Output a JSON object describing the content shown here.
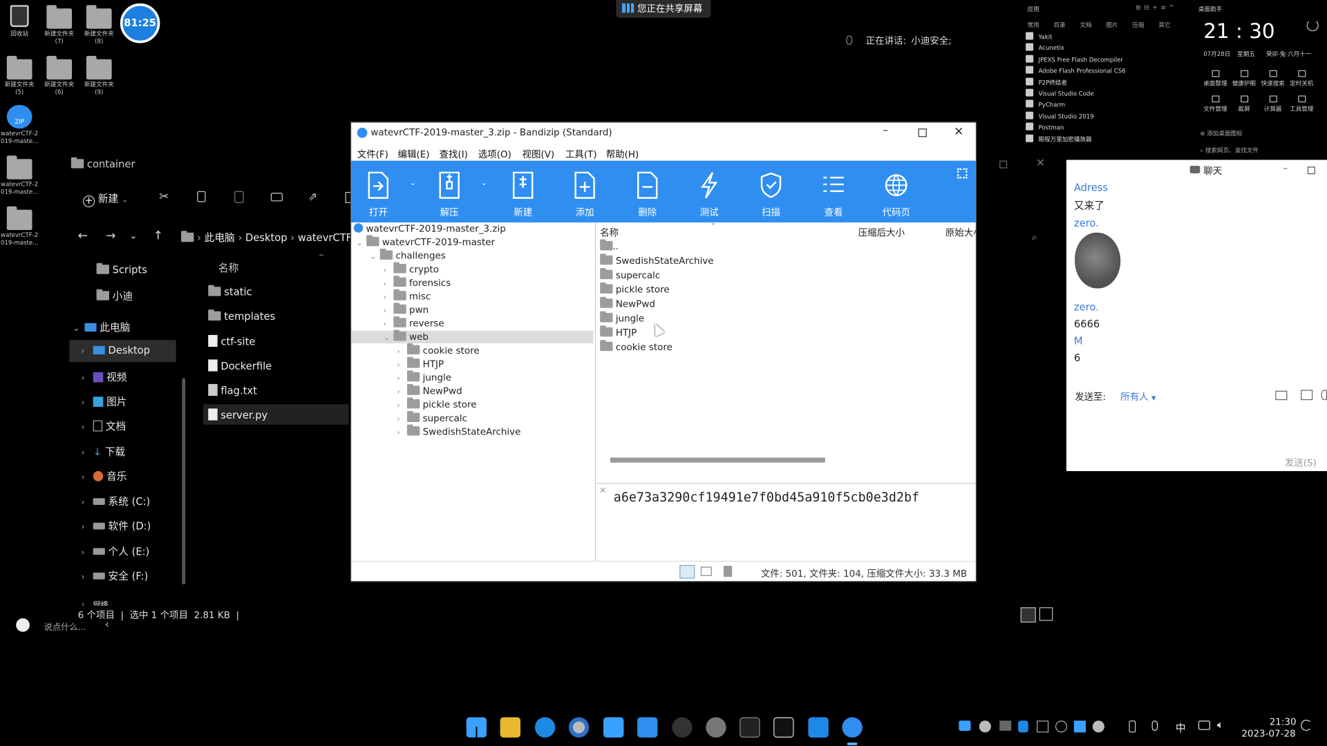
{
  "share_banner": "您正在共享屏幕",
  "speaking": {
    "label": "正在讲话:",
    "name": "小迪安全;"
  },
  "desktop": {
    "timer": "81:25",
    "icons": [
      "回收站",
      "新建文件夹\n(7)",
      "新建文件夹\n(8)",
      "新建文件夹\n(5)",
      "新建文件夹\n(6)",
      "新建文件夹\n(9)",
      "watevrCTF-2\n019-maste...",
      "watevrCTF-2\n019-maste...",
      "watevrCTF-2\n019-maste..."
    ]
  },
  "explorer": {
    "title": "container",
    "new_label": "新建",
    "breadcrumb": [
      "此电脑",
      "Desktop",
      "watevrCTF"
    ],
    "column_name": "名称",
    "nav": [
      "Scripts",
      "小迪",
      "此电脑",
      "Desktop",
      "视频",
      "图片",
      "文档",
      "下载",
      "音乐",
      "系统 (C:)",
      "软件 (D:)",
      "个人 (E:)",
      "安全 (F:)",
      "网络"
    ],
    "files": [
      "static",
      "templates",
      "ctf-site",
      "Dockerfile",
      "flag.txt",
      "server.py"
    ],
    "status": "6 个项目  |  选中 1 个项目  2.81 KB  |"
  },
  "chat_input_placeholder": "说点什么...",
  "bandizip": {
    "title": "watevrCTF-2019-master_3.zip - Bandizip (Standard)",
    "menus": [
      "文件(F)",
      "编辑(E)",
      "查找(I)",
      "选项(O)",
      "视图(V)",
      "工具(T)",
      "帮助(H)"
    ],
    "toolbar": [
      "打开",
      "解压",
      "新建",
      "添加",
      "删除",
      "测试",
      "扫描",
      "查看",
      "代码页"
    ],
    "tree": {
      "root": "watevrCTF-2019-master_3.zip",
      "level1": "watevrCTF-2019-master",
      "level2": "challenges",
      "categories": [
        "crypto",
        "forensics",
        "misc",
        "pwn",
        "reverse",
        "web"
      ],
      "web_children": [
        "cookie store",
        "HTJP",
        "jungle",
        "NewPwd",
        "pickle store",
        "supercalc",
        "SwedishStateArchive"
      ]
    },
    "columns": {
      "name": "名称",
      "compressed": "压缩后大小",
      "original": "原始大小"
    },
    "list": [
      "..",
      "SwedishStateArchive",
      "supercalc",
      "pickle store",
      "NewPwd",
      "jungle",
      "HTJP",
      "cookie store"
    ],
    "hash": "a6e73a3290cf19491e7f0bd45a910f5cb0e3d2bf",
    "status": "文件: 501, 文件夹: 104, 压缩文件大小: 33.3 MB"
  },
  "launcher": {
    "header": "应用",
    "tabs": [
      "常用",
      "目录",
      "文档",
      "图片",
      "压缩",
      "其它"
    ],
    "apps": [
      "Yakit",
      "Acunetix",
      "JPEXS Free Flash Decompiler",
      "Adobe Flash Professional CS6",
      "P2P终结者",
      "Visual Studio Code",
      "PyCharm",
      "Visual Studio 2019",
      "Postman",
      "眼程万里加密播放器"
    ],
    "footer": "添加桌面图标"
  },
  "clock_widget": {
    "title": "桌面助手",
    "time": "21 : 30",
    "date": "07月28日",
    "weekday": "星期五",
    "lunar": "癸卯·兔·六月十一",
    "tools": [
      "桌面整理",
      "健康护眼",
      "快速搜索",
      "定时关机",
      "文件管理",
      "截屏",
      "计算器",
      "工具管理"
    ],
    "search": "搜索网页、查找文件"
  },
  "chat": {
    "title": "聊天",
    "messages": [
      {
        "user": "Adress",
        "text": "又来了"
      },
      {
        "user": "zero.",
        "text": ""
      },
      {
        "user": "zero.",
        "text": "6666"
      },
      {
        "user": "M",
        "text": "6"
      }
    ],
    "send_to_label": "发送至:",
    "send_to_value": "所有人",
    "send_button": "发送(S)"
  },
  "taskbar": {
    "ime": "中",
    "time": "21:30",
    "date": "2023-07-28"
  }
}
